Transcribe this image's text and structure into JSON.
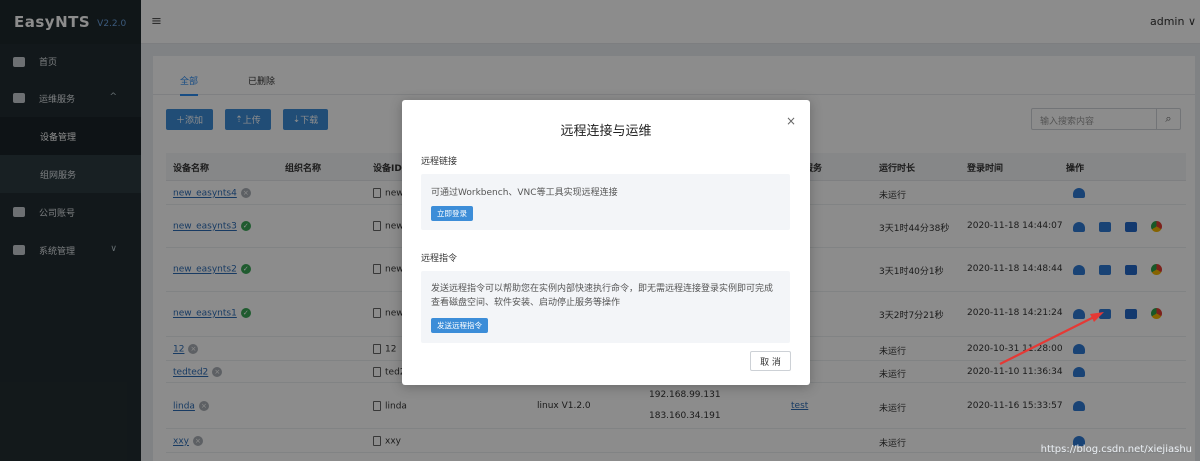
{
  "brand": {
    "name": "EasyNTS",
    "version": "V2.2.0"
  },
  "topbar": {
    "menu_icon": "hamburger-icon",
    "user": "admin",
    "user_chevron": "∨"
  },
  "sidebar": {
    "items": [
      {
        "label": "首页",
        "icon": "home-icon"
      },
      {
        "label": "运维服务",
        "icon": "gear-icon",
        "chevron": "^"
      },
      {
        "label": "设备管理"
      },
      {
        "label": "组网服务"
      },
      {
        "label": "公司账号",
        "icon": "user-icon"
      },
      {
        "label": "系统管理",
        "icon": "computer-icon",
        "chevron": "∨"
      }
    ]
  },
  "tabs": [
    "全部",
    "已删除"
  ],
  "toolbar": {
    "add": "添加",
    "upload": "上传",
    "download": "下载",
    "search_placeholder": "输入搜索内容",
    "search_icon": "search-icon"
  },
  "table": {
    "headers": [
      "设备名称",
      "组织名称",
      "设备ID",
      "服务",
      "运行时长",
      "登录时间",
      "操作"
    ],
    "rows": [
      {
        "name": "new_easynts4",
        "status": "offline",
        "id": "new",
        "runtime": "未运行",
        "login": ""
      },
      {
        "name": "new_easynts3",
        "status": "online",
        "id": "new",
        "runtime": "3天1时44分38秒",
        "login": "2020-11-18 14:44:07"
      },
      {
        "name": "new_easynts2",
        "status": "online",
        "id": "new",
        "runtime": "3天1时40分1秒",
        "login": "2020-11-18 14:48:44"
      },
      {
        "name": "new_easynts1",
        "status": "online",
        "id": "new",
        "runtime": "3天2时7分21秒",
        "login": "2020-11-18 14:21:24"
      },
      {
        "name": "12",
        "status": "offline",
        "id": "12",
        "runtime": "未运行",
        "login": "2020-10-31 11:28:00"
      },
      {
        "name": "tedted2",
        "status": "offline",
        "id": "ted2",
        "runtime": "未运行",
        "login": "2020-11-10 11:36:34"
      },
      {
        "name": "linda",
        "status": "offline",
        "id": "linda",
        "version": "linux V1.2.0",
        "ip1": "192.168.99.131",
        "ip2": "183.160.34.191",
        "service": "test",
        "runtime": "未运行",
        "login": "2020-11-16 15:33:57"
      },
      {
        "name": "xxy",
        "status": "offline",
        "id": "xxy",
        "runtime": "未运行",
        "login": ""
      }
    ]
  },
  "modal": {
    "title": "远程连接与运维",
    "close": "×",
    "sec1_title": "远程链接",
    "sec1_text": "可通过Workbench、VNC等工具实现远程连接",
    "sec1_button": "立即登录",
    "sec2_title": "远程指令",
    "sec2_text": "发送远程指令可以帮助您在实例内部快速执行命令，即无需远程连接登录实例即可完成查看磁盘空间、软件安装、启动停止服务等操作",
    "sec2_button": "发送远程指令",
    "cancel": "取 消"
  },
  "watermark": "https://blog.csdn.net/xiejiashu",
  "colors": {
    "sidebar": "#222d32",
    "accent": "#3c8dd8",
    "online": "#3aa757",
    "arrow": "#e53935"
  }
}
